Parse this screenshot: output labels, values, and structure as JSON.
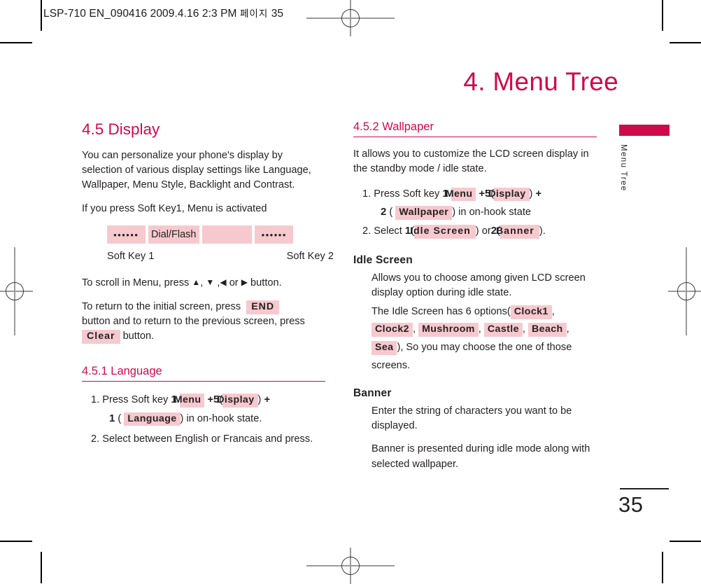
{
  "running_head": {
    "text": "LSP-710 EN_090416  2009.4.16 2:3 PM",
    "korean": "페이지",
    "page_ref": "35"
  },
  "chapter": {
    "title": "4. Menu Tree"
  },
  "side_tab": {
    "label": "Menu Tree",
    "bar_color": "#cf0a4b"
  },
  "footer": {
    "page_number": "35"
  },
  "colors": {
    "accent": "#cf0a4b",
    "chip_bg": "#f6c9ce",
    "body_text": "#231f20"
  },
  "left_column": {
    "section_title": "4.5 Display",
    "intro": "You can personalize your phone's display by selection of various display settings like Language, Wallpaper, Menu Style, Backlight and Contrast.",
    "softkey_line": "If you press Soft Key1, Menu is activated",
    "keybar": {
      "seg1_dots": "••••••",
      "seg2_label": "Dial/Flash",
      "seg3_blank": "",
      "seg4_dots": "••••••"
    },
    "softkey_labels": {
      "left": "Soft Key 1",
      "right": "Soft Key 2"
    },
    "scroll_line": {
      "prefix": "To scroll in Menu, press",
      "up": "▲",
      "down": "▼",
      "left": "◀",
      "or": "or",
      "right": "▶",
      "suffix": "button."
    },
    "return_line": {
      "part1": "To return to the initial screen, press",
      "end_key": "END",
      "part2": "button and to return to the previous screen, press",
      "clear_key": "Clear",
      "part3": "button."
    },
    "subsection": {
      "title": "4.5.1 Language",
      "step1": {
        "prefix": "1. Press Soft key",
        "n1": "1",
        "key_menu": "Menu",
        "plus1": "+",
        "n2": "5",
        "open1": "(",
        "key_display": "Display",
        "close1": ")",
        "plus2": "+",
        "n3": "1",
        "open2": "(",
        "key_language": "Language",
        "close2": ")",
        "tail": "in on-hook state."
      },
      "step2": "2. Select between English or Francais and press."
    }
  },
  "right_column": {
    "subsection_title": "4.5.2 Wallpaper",
    "intro": "It allows you to customize the LCD screen display in the standby mode / idle state.",
    "step1": {
      "prefix": "1. Press Soft key",
      "n1": "1",
      "key_menu": "Menu",
      "plus1": "+",
      "n2": "5",
      "open1": "(",
      "key_display": "Display",
      "close1": ")",
      "plus2": "+",
      "n3": "2",
      "open2": "(",
      "key_wallpaper": "Wallpaper",
      "close2": ")",
      "tail": "in on-hook state"
    },
    "step2": {
      "prefix": "2. Select",
      "n1": "1",
      "open1": "(",
      "key_idle": "Idle Screen",
      "close1": ")",
      "or": "or",
      "n2": "2",
      "open2": "(",
      "key_banner": "Banner",
      "close2": ")."
    },
    "idle_screen": {
      "heading": "Idle Screen",
      "para1": "Allows you to choose among given LCD screen display option during idle state.",
      "options_prefix": "The  Idle Screen has 6 options(",
      "options": [
        "Clock1",
        "Clock2",
        "Mushroom",
        "Castle",
        "Beach",
        "Sea"
      ],
      "options_suffix": "), So you may choose the one of those screens."
    },
    "banner": {
      "heading": "Banner",
      "para1": "Enter the string of characters you want to be displayed.",
      "para2": "Banner is presented during idle mode along with selected wallpaper."
    }
  }
}
